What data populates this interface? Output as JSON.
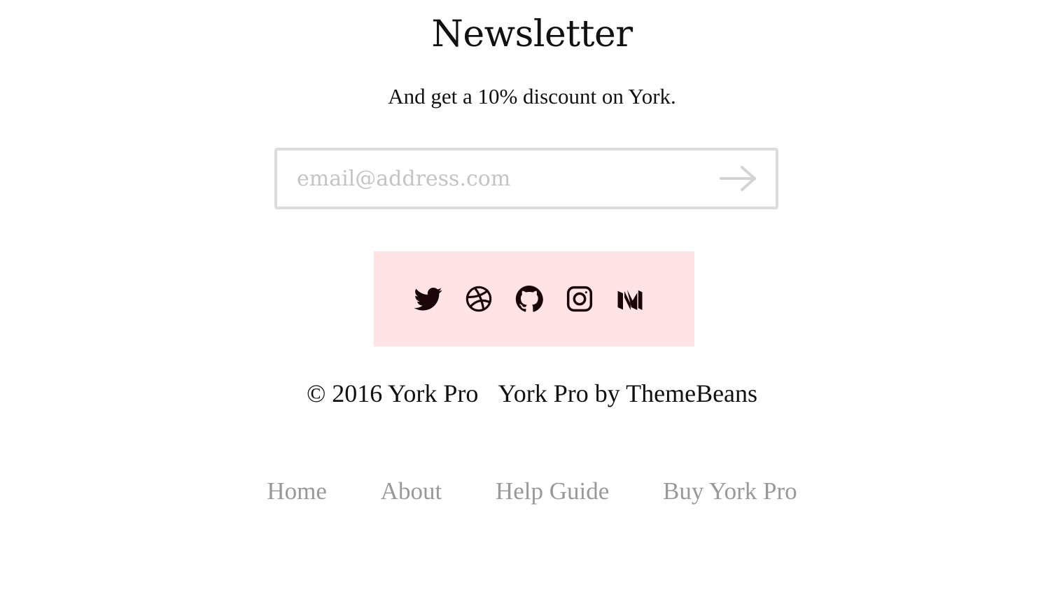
{
  "newsletter": {
    "title": "Newsletter",
    "subtitle": "And get a 10% discount on York.",
    "email_placeholder": "email@address.com",
    "email_value": "",
    "submit_icon": "arrow-right-icon"
  },
  "social": {
    "background_color": "#ffe3e5",
    "icon_color": "#1a0508",
    "items": [
      {
        "icon": "twitter-icon"
      },
      {
        "icon": "dribbble-icon"
      },
      {
        "icon": "github-icon"
      },
      {
        "icon": "instagram-icon"
      },
      {
        "icon": "medium-icon"
      }
    ]
  },
  "footer": {
    "copyright": "© 2016 York Pro",
    "credit": "York Pro by ThemeBeans",
    "link_color": "#999999",
    "nav": [
      {
        "label": "Home"
      },
      {
        "label": "About"
      },
      {
        "label": "Help Guide"
      },
      {
        "label": "Buy York Pro"
      }
    ]
  }
}
